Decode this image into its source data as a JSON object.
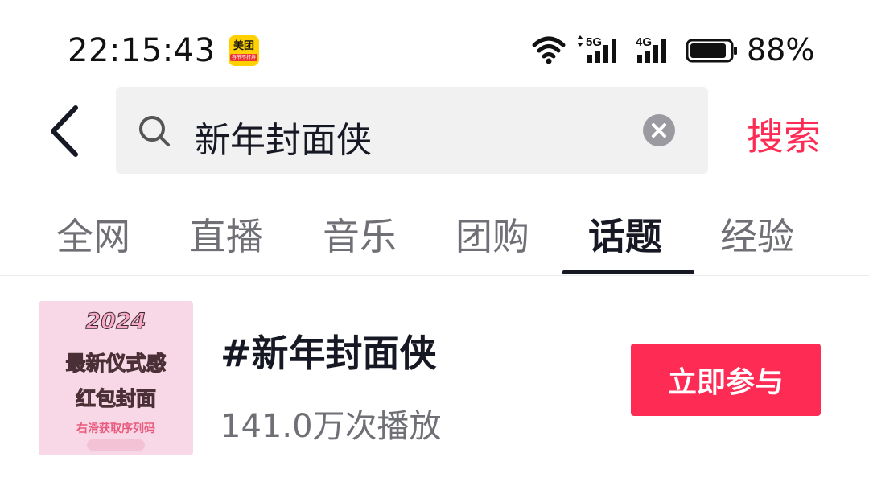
{
  "status_bar": {
    "time": "22:15:43",
    "app_badge_main": "美团",
    "app_badge_sub": "春节不打烊",
    "network_1": "5G",
    "network_2": "4G",
    "battery": "88%"
  },
  "search": {
    "query": "新年封面侠",
    "submit_label": "搜索"
  },
  "tabs": [
    {
      "label": "全网"
    },
    {
      "label": "直播"
    },
    {
      "label": "音乐"
    },
    {
      "label": "团购"
    },
    {
      "label": "话题",
      "active": true
    },
    {
      "label": "经验"
    }
  ],
  "topic": {
    "title": "#新年封面侠",
    "views": "141.0万次播放",
    "join_label": "立即参与",
    "cover": {
      "year": "2024",
      "line1": "最新仪式感",
      "line2": "红包封面",
      "line3": "右滑获取序列码"
    }
  },
  "colors": {
    "accent": "#fe2c55",
    "text_primary": "#161823",
    "text_secondary": "#6f6f76",
    "search_bg": "#f1f1f2"
  }
}
